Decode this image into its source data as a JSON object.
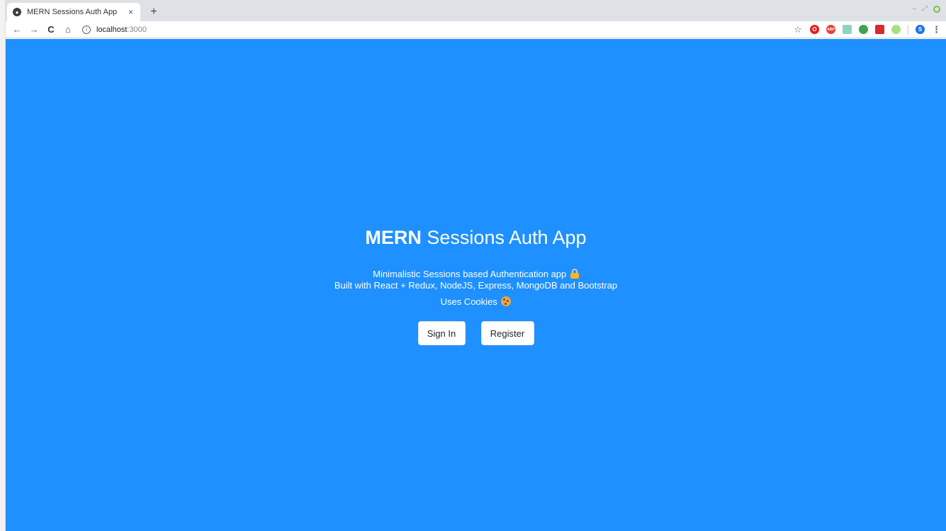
{
  "browser": {
    "tab": {
      "title": "MERN Sessions Auth App",
      "close": "×"
    },
    "new_tab": "+",
    "window_controls": {
      "minimize": "–",
      "restore": "⤢"
    },
    "nav": {
      "back": "←",
      "forward": "→",
      "reload": "C",
      "home": "⌂"
    },
    "url": {
      "host": "localhost",
      "port": ":3000",
      "info": "i"
    },
    "bookmark": "☆",
    "extensions": [
      {
        "name": "opera-icon",
        "label": "O",
        "color": "#e0201b"
      },
      {
        "name": "adblock-icon",
        "label": "ABP",
        "color": "#e44136"
      },
      {
        "name": "screenshot-icon",
        "label": "",
        "color": "#8fd3c1"
      },
      {
        "name": "globe-ext-icon",
        "label": "",
        "color": "#3fa34d"
      },
      {
        "name": "tracker-icon",
        "label": "",
        "color": "#d62b2b"
      },
      {
        "name": "leaf-icon",
        "label": "",
        "color": "#a8e07f"
      }
    ],
    "profile": "S",
    "menu": "⋮"
  },
  "hero": {
    "title_bold": "MERN",
    "title_rest": " Sessions Auth App",
    "desc_line1": "Minimalistic Sessions based Authentication app",
    "desc_line2": "Built with React + Redux, NodeJS, Express, MongoDB and Bootstrap",
    "cookie_line": "Uses Cookies"
  },
  "buttons": {
    "sign_in": "Sign In",
    "register": "Register"
  },
  "colors": {
    "page_background": "#1e90ff",
    "text": "#ffffff"
  }
}
